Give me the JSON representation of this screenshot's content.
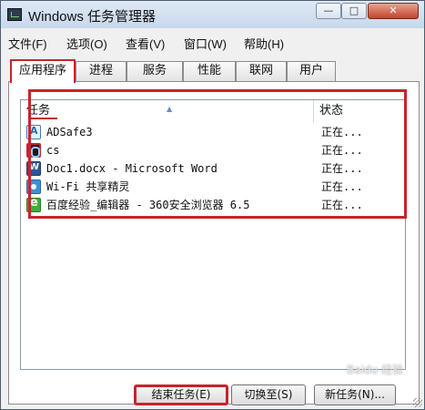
{
  "window": {
    "title": "Windows 任务管理器",
    "controls": {
      "minimize": "—",
      "maximize": "□",
      "close": "✕"
    }
  },
  "menu": [
    "文件(F)",
    "选项(O)",
    "查看(V)",
    "窗口(W)",
    "帮助(H)"
  ],
  "tabs": [
    "应用程序",
    "进程",
    "服务",
    "性能",
    "联网",
    "用户"
  ],
  "table": {
    "columns": {
      "task": "任务",
      "status": "状态"
    },
    "rows": [
      {
        "name": "ADSafe3",
        "status": "正在...",
        "icon": "adsafe-icon"
      },
      {
        "name": "cs",
        "status": "正在...",
        "icon": "cs-app-icon"
      },
      {
        "name": "Doc1.docx - Microsoft Word",
        "status": "正在...",
        "icon": "word-icon"
      },
      {
        "name": "Wi-Fi 共享精灵",
        "status": "正在...",
        "icon": "wifi-icon"
      },
      {
        "name": "百度经验_编辑器 - 360安全浏览器 6.5",
        "status": "正在...",
        "icon": "browser-360-icon"
      }
    ]
  },
  "buttons": {
    "end_task": "结束任务(E)",
    "switch_to": "切换至(S)",
    "new_task": "新任务(N)..."
  },
  "colors": {
    "annotation_red": "#c8242a"
  }
}
